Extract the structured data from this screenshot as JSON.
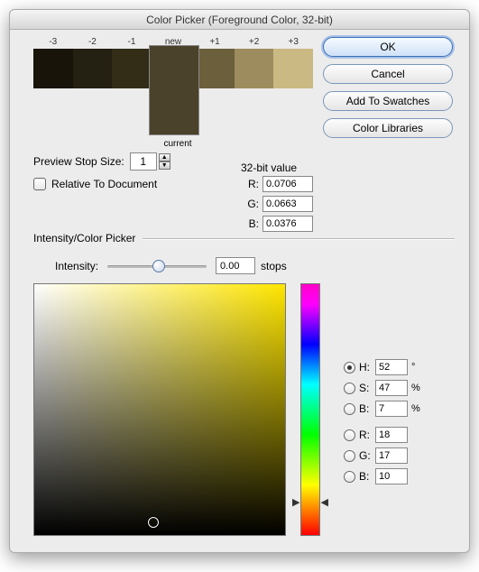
{
  "title": "Color Picker (Foreground Color, 32-bit)",
  "swatch": {
    "new_label": "new",
    "current_label": "current",
    "stops": [
      "-3",
      "-2",
      "-1",
      "+1",
      "+2",
      "+3"
    ],
    "colors": {
      "m3": "#181409",
      "m2": "#242012",
      "m1": "#332d18",
      "p1": "#6c5f3c",
      "p2": "#9d8c5e",
      "p3": "#cbb983",
      "new": "#4b422b",
      "current": "#4b422b"
    }
  },
  "buttons": {
    "ok": "OK",
    "cancel": "Cancel",
    "add_swatches": "Add To Swatches",
    "color_libraries": "Color Libraries"
  },
  "preview": {
    "label": "Preview Stop Size:",
    "value": "1",
    "relative_label": "Relative To Document"
  },
  "bit32": {
    "title": "32-bit value",
    "r_label": "R:",
    "g_label": "G:",
    "b_label": "B:",
    "r": "0.0706",
    "g": "0.0663",
    "b": "0.0376"
  },
  "section": "Intensity/Color Picker",
  "intensity": {
    "label": "Intensity:",
    "value": "0.00",
    "unit": "stops"
  },
  "hsb": {
    "h_label": "H:",
    "h": "52",
    "h_unit": "°",
    "s_label": "S:",
    "s": "47",
    "s_unit": "%",
    "b_label": "B:",
    "b": "7",
    "b_unit": "%"
  },
  "rgb": {
    "r_label": "R:",
    "r": "18",
    "g_label": "G:",
    "g": "17",
    "b_label": "B:",
    "b": "10"
  },
  "selected_model": "H"
}
